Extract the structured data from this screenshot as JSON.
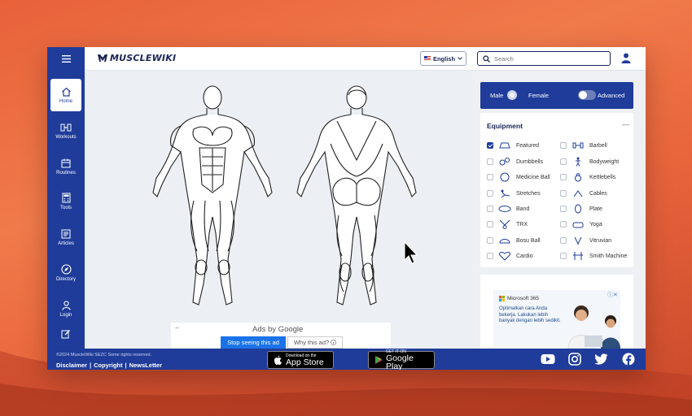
{
  "brand": {
    "name": "MUSCLEWIKI"
  },
  "header": {
    "language": "English",
    "search_placeholder": "Search"
  },
  "sidebar": {
    "items": [
      {
        "label": "Home",
        "icon": "home-icon"
      },
      {
        "label": "Workouts",
        "icon": "workouts-icon"
      },
      {
        "label": "Routines",
        "icon": "calendar-icon"
      },
      {
        "label": "Tools",
        "icon": "calculator-icon"
      },
      {
        "label": "Articles",
        "icon": "articles-icon"
      },
      {
        "label": "Directory",
        "icon": "directory-icon"
      },
      {
        "label": "Login",
        "icon": "user-icon"
      }
    ]
  },
  "gender": {
    "male": "Male",
    "female": "Female",
    "advanced": "Advanced"
  },
  "equipment": {
    "title": "Equipment",
    "items": [
      {
        "label": "Featured",
        "checked": true
      },
      {
        "label": "Barbell",
        "checked": false
      },
      {
        "label": "Dumbbells",
        "checked": false
      },
      {
        "label": "Bodyweight",
        "checked": false
      },
      {
        "label": "Medicine Ball",
        "checked": false
      },
      {
        "label": "Kettlebells",
        "checked": false
      },
      {
        "label": "Stretches",
        "checked": false
      },
      {
        "label": "Cables",
        "checked": false
      },
      {
        "label": "Band",
        "checked": false
      },
      {
        "label": "Plate",
        "checked": false
      },
      {
        "label": "TRX",
        "checked": false
      },
      {
        "label": "Yoga",
        "checked": false
      },
      {
        "label": "Bosu Ball",
        "checked": false
      },
      {
        "label": "Vitruvian",
        "checked": false
      },
      {
        "label": "Cardio",
        "checked": false
      },
      {
        "label": "Smith Machine",
        "checked": false
      }
    ]
  },
  "ads": {
    "title": "Ads by Google",
    "stop": "Stop seeing this ad",
    "why": "Why this ad?",
    "ms_brand": "Microsoft 365",
    "ms_copy": "Optimalkan cara Anda bekerja. Lakukan lebih banyak dengan lebih sedikit."
  },
  "footer": {
    "copyright": "©2024 MuscleWiki SEZC Some rights reserved.",
    "disclaimer": "Disclaimer",
    "copyright_link": "Copyright",
    "newsletter": "NewsLetter",
    "app_store_small": "Download on the",
    "app_store_big": "App Store",
    "play_small": "GET IT ON",
    "play_big": "Google Play"
  }
}
